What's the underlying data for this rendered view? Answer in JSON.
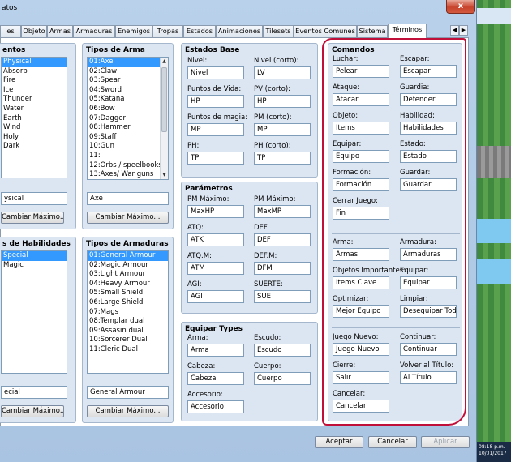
{
  "window": {
    "title": "atos",
    "close_label": "x"
  },
  "tabs": [
    {
      "label": "es",
      "active": false
    },
    {
      "label": "Objeto",
      "active": false
    },
    {
      "label": "Armas",
      "active": false
    },
    {
      "label": "Armaduras",
      "active": false
    },
    {
      "label": "Enemigos",
      "active": false
    },
    {
      "label": "Tropas",
      "active": false
    },
    {
      "label": "Estados",
      "active": false
    },
    {
      "label": "Animaciones",
      "active": false
    },
    {
      "label": "Tilesets",
      "active": false
    },
    {
      "label": "Eventos Comunes",
      "active": false
    },
    {
      "label": "Sistema",
      "active": false
    },
    {
      "label": "Términos",
      "active": true
    }
  ],
  "tab_scroll": {
    "left": "◀",
    "right": "▶"
  },
  "elements_panel": {
    "title": "entos",
    "items": [
      "Physical",
      "Absorb",
      "Fire",
      "Ice",
      "Thunder",
      "Water",
      "Earth",
      "Wind",
      "Holy",
      "Dark"
    ],
    "selected": 0,
    "field_value": "ysical",
    "button": "Cambiar Máximo..."
  },
  "weapon_types": {
    "title": "Tipos de Arma",
    "items": [
      "01:Axe",
      "02:Claw",
      "03:Spear",
      "04:Sword",
      "05:Katana",
      "06:Bow",
      "07:Dagger",
      "08:Hammer",
      "09:Staff",
      "10:Gun",
      "11:",
      "12:Orbs / speelbooks",
      "13:Axes/ War guns"
    ],
    "selected": 0,
    "field_value": "Axe",
    "button": "Cambiar Máximo..."
  },
  "skill_types": {
    "title": "s de Habilidades",
    "items": [
      "Special",
      "Magic"
    ],
    "selected": 0,
    "field_value": "ecial",
    "button": "Cambiar Máximo..."
  },
  "armor_types": {
    "title": "Tipos de Armaduras",
    "items": [
      "01:General Armour",
      "02:Magic Armour",
      "03:Light Armour",
      "04:Heavy Armour",
      "05:Small Shield",
      "06:Large Shield",
      "07:Mags",
      "08:Templar dual",
      "09:Assasin dual",
      "10:Sorcerer Dual",
      "11:Cleric Dual"
    ],
    "selected": 0,
    "field_value": "General Armour",
    "button": "Cambiar Máximo..."
  },
  "basic_status": {
    "title": "Estados Base",
    "rows": [
      {
        "l1": "Nivel:",
        "v1": "Nivel",
        "l2": "Nivel (corto):",
        "v2": "LV"
      },
      {
        "l1": "Puntos de Vida:",
        "v1": "HP",
        "l2": "PV (corto):",
        "v2": "HP"
      },
      {
        "l1": "Puntos de magia:",
        "v1": "MP",
        "l2": "PM (corto):",
        "v2": "MP"
      },
      {
        "l1": "PH:",
        "v1": "TP",
        "l2": "PH (corto):",
        "v2": "TP"
      }
    ]
  },
  "parameters": {
    "title": "Parámetros",
    "rows": [
      {
        "l1": "PM Máximo:",
        "v1": "MaxHP",
        "l2": "PM Máximo:",
        "v2": "MaxMP"
      },
      {
        "l1": "ATQ:",
        "v1": "ATK",
        "l2": "DEF:",
        "v2": "DEF"
      },
      {
        "l1": "ATQ.M:",
        "v1": "ATM",
        "l2": "DEF.M:",
        "v2": "DFM"
      },
      {
        "l1": "AGI:",
        "v1": "AGI",
        "l2": "SUERTE:",
        "v2": "SUE"
      }
    ]
  },
  "equip_types": {
    "title": "Equipar Types",
    "rows": [
      {
        "l1": "Arma:",
        "v1": "Arma",
        "l2": "Escudo:",
        "v2": "Escudo"
      },
      {
        "l1": "Cabeza:",
        "v1": "Cabeza",
        "l2": "Cuerpo:",
        "v2": "Cuerpo"
      },
      {
        "l1": "Accesorio:",
        "v1": "Accesorio",
        "l2": "",
        "v2": ""
      }
    ]
  },
  "commands": {
    "title": "Comandos",
    "block1": [
      {
        "l1": "Luchar:",
        "v1": "Pelear",
        "l2": "Escapar:",
        "v2": "Escapar"
      },
      {
        "l1": "Ataque:",
        "v1": "Atacar",
        "l2": "Guardia:",
        "v2": "Defender"
      },
      {
        "l1": "Objeto:",
        "v1": "Items",
        "l2": "Habilidad:",
        "v2": "Habilidades"
      },
      {
        "l1": "Equipar:",
        "v1": "Equipo",
        "l2": "Estado:",
        "v2": "Estado"
      },
      {
        "l1": "Formación:",
        "v1": "Formación",
        "l2": "Guardar:",
        "v2": "Guardar"
      },
      {
        "l1": "Cerrar Juego:",
        "v1": "Fin",
        "l2": "",
        "v2": ""
      }
    ],
    "block2": [
      {
        "l1": "Arma:",
        "v1": "Armas",
        "l2": "Armadura:",
        "v2": "Armaduras"
      },
      {
        "l1": "Objetos Importantes:",
        "v1": "Items Clave",
        "l2": "Equipar:",
        "v2": "Equipar"
      },
      {
        "l1": "Optimizar:",
        "v1": "Mejor Equipo",
        "l2": "Limpiar:",
        "v2": "Desequipar Todo"
      }
    ],
    "block3": [
      {
        "l1": "Juego Nuevo:",
        "v1": "Juego Nuevo",
        "l2": "Continuar:",
        "v2": "Continuar"
      },
      {
        "l1": "Cierre:",
        "v1": "Salir",
        "l2": "Volver al Título:",
        "v2": "Al Título"
      },
      {
        "l1": "Cancelar:",
        "v1": "Cancelar",
        "l2": "",
        "v2": ""
      }
    ]
  },
  "footer": {
    "ok": "Aceptar",
    "cancel": "Cancelar",
    "apply": "Aplicar"
  },
  "taskbar": {
    "time": "08:18 p.m.",
    "date": "10/01/2017"
  },
  "colors": {
    "selection": "#3399ff",
    "annotation": "#c0103a",
    "panel": "#dce6f2"
  }
}
